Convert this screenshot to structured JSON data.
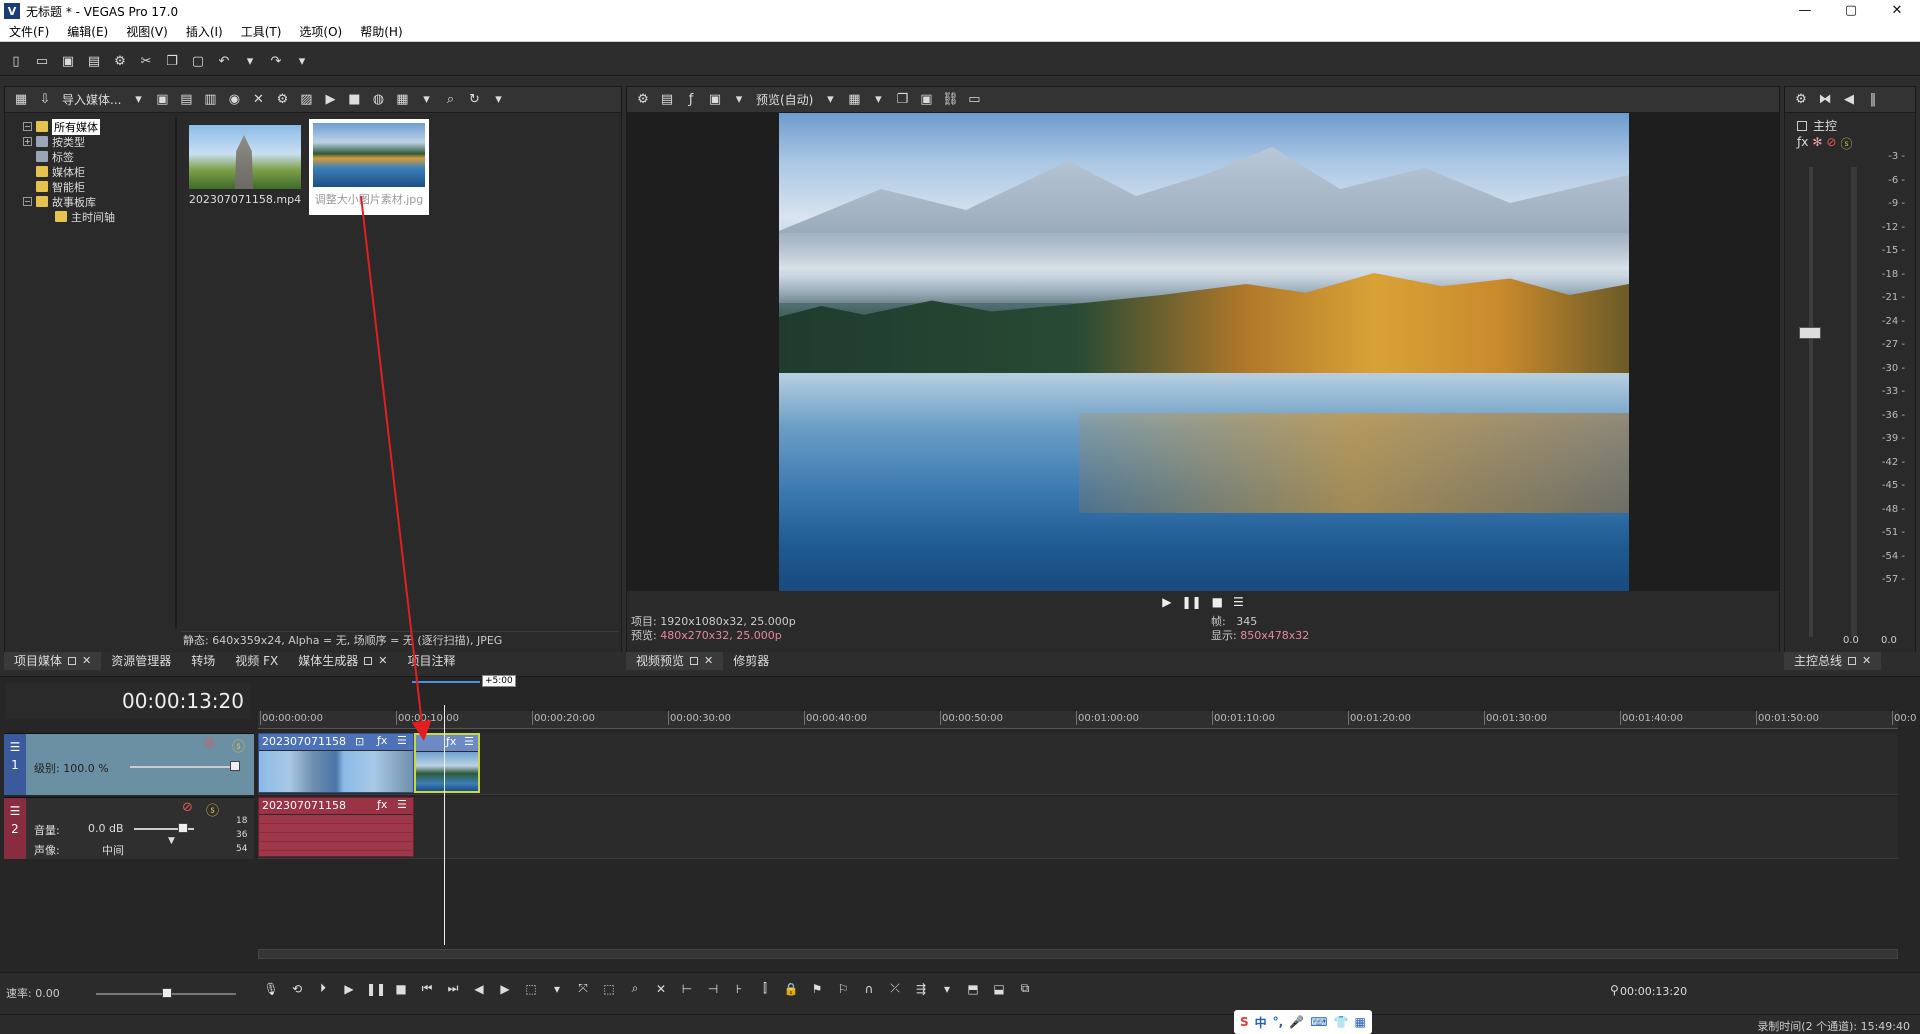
{
  "window": {
    "title": "无标题 * - VEGAS Pro 17.0",
    "app_icon": "V",
    "controls": [
      "—",
      "▢",
      "✕"
    ]
  },
  "menu": [
    "文件(F)",
    "编辑(E)",
    "视图(V)",
    "插入(I)",
    "工具(T)",
    "选项(O)",
    "帮助(H)"
  ],
  "media": {
    "import_label": "导入媒体...",
    "tree": [
      {
        "label": "所有媒体",
        "selected": true
      },
      {
        "label": "按类型"
      },
      {
        "label": "标签"
      },
      {
        "label": "媒体柜"
      },
      {
        "label": "智能柜"
      },
      {
        "label": "故事板库"
      },
      {
        "label": "主时间轴"
      }
    ],
    "thumbs": [
      {
        "caption": "202307071158.mp4"
      },
      {
        "caption": "调整大小图片素材.jpg"
      }
    ],
    "status": "静态: 640x359x24, Alpha = 无, 场顺序 = 无 (逐行扫描), JPEG",
    "tabs": [
      "项目媒体",
      "资源管理器",
      "转场",
      "视频 FX",
      "媒体生成器",
      "项目注释"
    ]
  },
  "preview": {
    "mode_label": "预览(自动)",
    "info": {
      "project": "项目: 1920x1080x32, 25.000p",
      "preview_prefix": "预览: ",
      "preview_value": "480x270x32, 25.000p",
      "frame_label": "帧:",
      "frame_value": "345",
      "display_label": "显示:",
      "display_value": "850x478x32"
    },
    "tabs": [
      "视频预览",
      "修剪器"
    ]
  },
  "master": {
    "label": "主控",
    "scale": [
      "3",
      "6",
      "9",
      "12",
      "15",
      "18",
      "21",
      "24",
      "27",
      "30",
      "33",
      "36",
      "39",
      "42",
      "45",
      "48",
      "51",
      "54",
      "57"
    ],
    "values": [
      "0.0",
      "0.0"
    ],
    "tab": "主控总线"
  },
  "timeline": {
    "timecode": "00:00:13:20",
    "offset_marker": "+5:00",
    "ruler": [
      "00:00:00:00",
      "00:00:10:00",
      "00:00:20:00",
      "00:00:30:00",
      "00:00:40:00",
      "00:00:50:00",
      "00:01:00:00",
      "00:01:10:00",
      "00:01:20:00",
      "00:01:30:00",
      "00:01:40:00",
      "00:01:50:00",
      "00:0"
    ],
    "video_track": {
      "number": "1",
      "level_label": "级别: 100.0 %",
      "clip_title": "202307071158"
    },
    "audio_track": {
      "number": "2",
      "volume_label": "音量:",
      "volume_value": "0.0 dB",
      "pan_label": "声像:",
      "pan_value": "中间",
      "clip_title": "202307071158",
      "meter_ticks": [
        "18",
        "36",
        "54"
      ]
    }
  },
  "bottom": {
    "rate": "速率: 0.00",
    "time": "00:00:13:20",
    "status": "录制时间(2 个通道): 15:49:40"
  },
  "ime": {
    "logo": "S",
    "lang": "中"
  }
}
